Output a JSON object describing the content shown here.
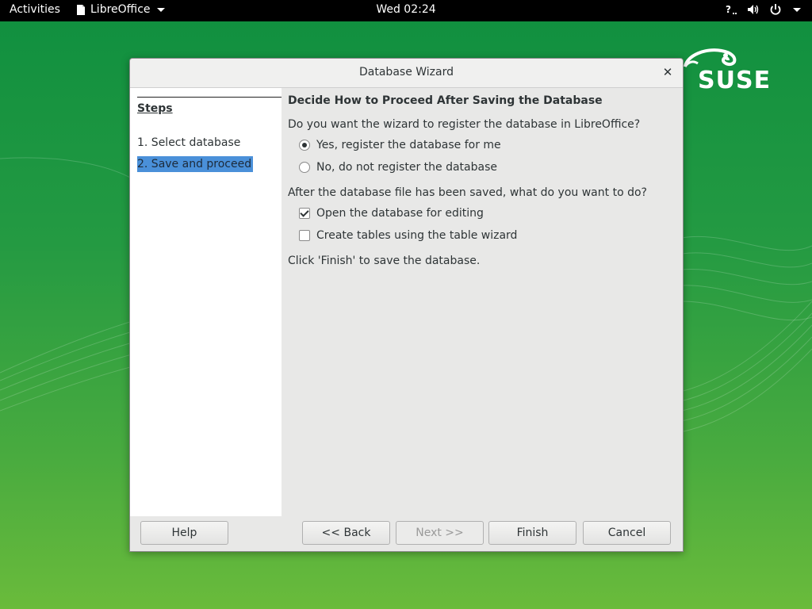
{
  "topbar": {
    "activities": "Activities",
    "app_name": "LibreOffice",
    "clock": "Wed 02:24"
  },
  "desktop": {
    "logo_text": "SUSE"
  },
  "dialog": {
    "title": "Database Wizard",
    "steps_heading": "Steps",
    "steps": [
      {
        "label": "1. Select database",
        "active": false
      },
      {
        "label": "2. Save and proceed",
        "active": true
      }
    ],
    "heading": "Decide How to Proceed After Saving the Database",
    "register_question": "Do you want the wizard to register the database in LibreOffice?",
    "register_options": [
      {
        "label": "Yes, register the database for me",
        "selected": true
      },
      {
        "label": "No, do not register the database",
        "selected": false
      }
    ],
    "after_question": "After the database file has been saved, what do you want to do?",
    "after_options": [
      {
        "label": "Open the database for editing",
        "checked": true
      },
      {
        "label": "Create tables using the table wizard",
        "checked": false
      }
    ],
    "finish_note": "Click 'Finish' to save the database.",
    "buttons": {
      "help": "Help",
      "back": "<< Back",
      "next": "Next >>",
      "finish": "Finish",
      "cancel": "Cancel"
    }
  },
  "colors": {
    "selection": "#4a90d9",
    "desktop_green": "#249a42"
  }
}
